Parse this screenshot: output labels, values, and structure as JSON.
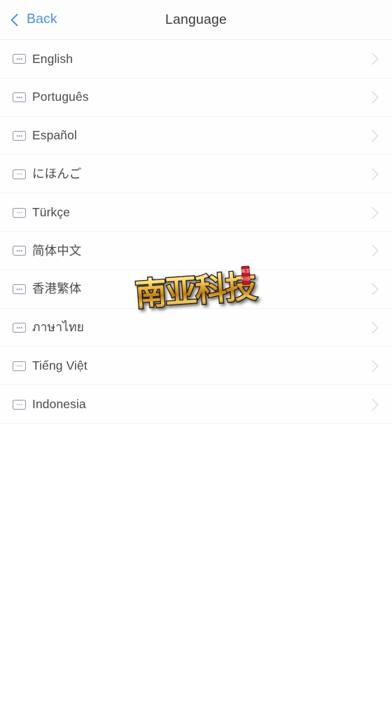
{
  "header": {
    "back_label": "Back",
    "back_icon": "chevron-left-icon",
    "title": "Language"
  },
  "list": {
    "row_icon": "broken-image-placeholder-icon",
    "row_chevron_icon": "chevron-right-icon",
    "items": [
      {
        "label": "English"
      },
      {
        "label": "Português"
      },
      {
        "label": "Español"
      },
      {
        "label": "にほんご"
      },
      {
        "label": "Türkçe"
      },
      {
        "label": "简体中文"
      },
      {
        "label": "香港繁体"
      },
      {
        "label": "ภาษาไทย"
      },
      {
        "label": "Tiếng Việt"
      },
      {
        "label": "Indonesia"
      }
    ]
  },
  "watermark": {
    "text": "南亚科技",
    "seal_text": "南亚科技",
    "gold_light": "#ffe9a0",
    "gold_mid": "#d8a12a",
    "gold_dark": "#8a5c0e",
    "outline": "#1a1008",
    "seal_color": "#c0182a"
  },
  "colors": {
    "accent": "#4a90e2",
    "title": "#3b3b3d",
    "label": "#4a4a4c",
    "chevron": "#cfcfd4",
    "separator": "#f2f2f4",
    "background": "#ffffff",
    "icon_border": "#9c8fa8"
  }
}
